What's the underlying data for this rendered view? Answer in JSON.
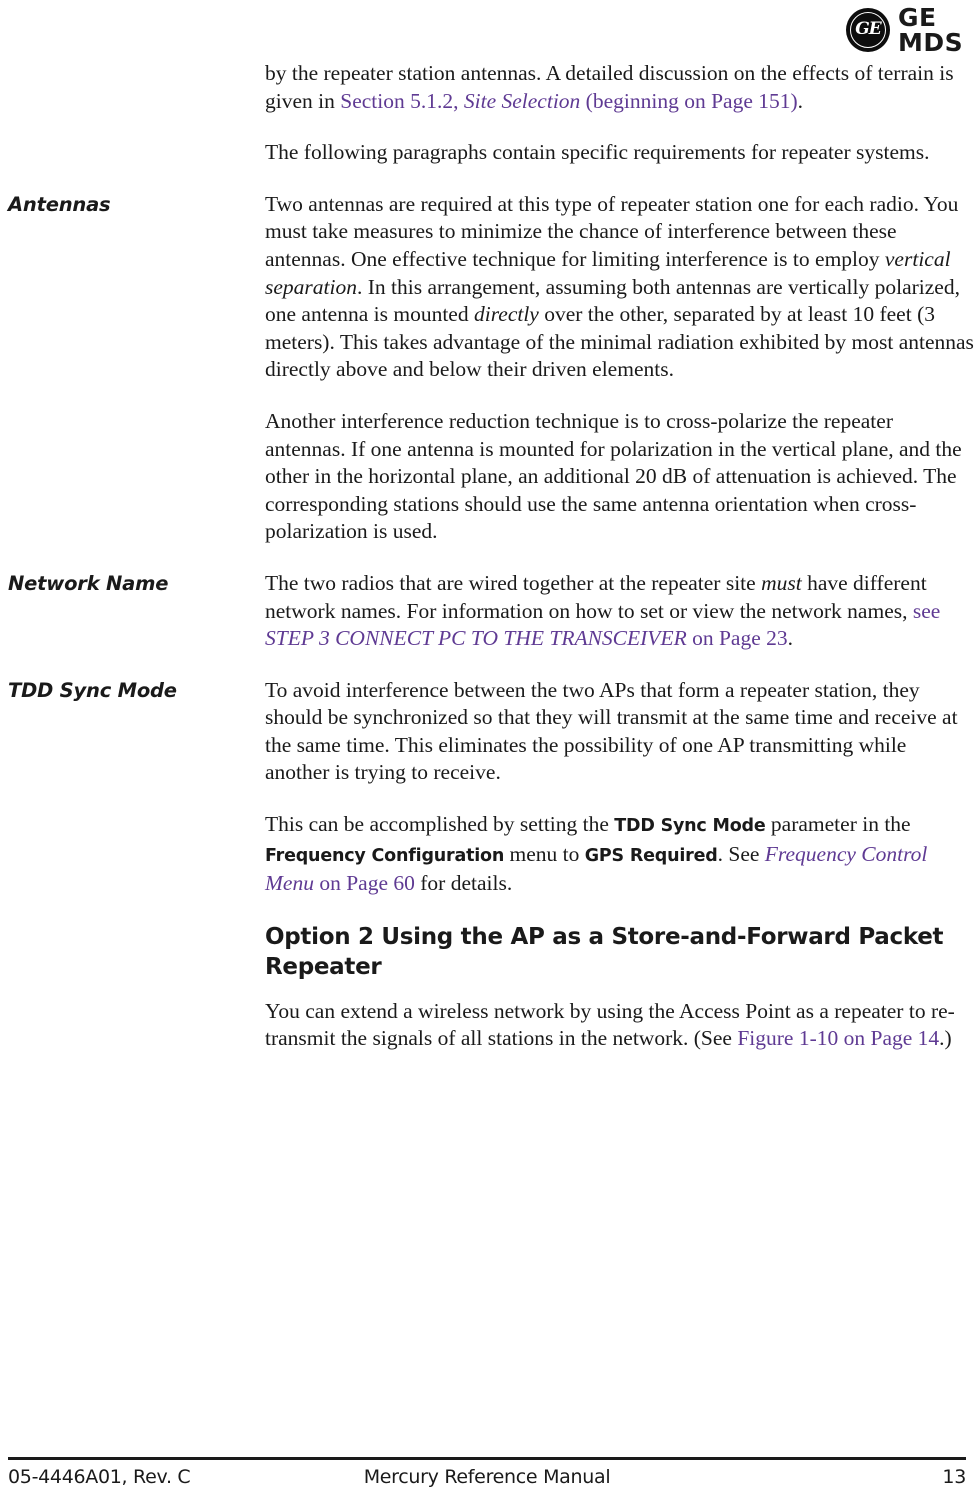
{
  "logo": {
    "monogram_text": "GE",
    "wordmark": "GE MDS"
  },
  "body": {
    "intro_paragraph_1_a": "by the repeater station antennas. A detailed discussion on the effects of terrain is given in ",
    "intro_paragraph_1_link_1": "Section 5.1.2, ",
    "intro_paragraph_1_link_1_italic": "Site Selection",
    "intro_paragraph_1_link_2": " (beginning on Page 151)",
    "intro_paragraph_1_end": ".",
    "intro_paragraph_2": "The following paragraphs contain specific requirements for repeater systems."
  },
  "antennas": {
    "heading": "Antennas",
    "para1_a": "Two antennas are required at this type of repeater station   one for each radio. You must take measures to minimize the chance of interference between these antennas. One effective technique for limiting interference is to employ ",
    "para1_italic1": "vertical separation",
    "para1_b": ". In this arrangement, assuming both antennas are vertically polarized, one antenna is mounted ",
    "para1_italic2": "directly",
    "para1_c": " over the other, separated by at least 10 feet (3 meters). This takes advantage of the minimal radiation exhibited by most antennas directly above and below their driven elements.",
    "para2": "Another interference reduction technique is to cross-polarize the repeater antennas. If one antenna is mounted for polarization in the vertical plane, and the other in the horizontal plane, an additional 20 dB of attenuation is achieved. The corresponding stations should use the same antenna orientation when cross-polarization is used."
  },
  "network_name": {
    "heading": "Network Name",
    "para_a": "The two radios that are wired together at the repeater site ",
    "para_italic": "must",
    "para_b": " have different network names. For information on how to set or view the network names, ",
    "link_see": "see  ",
    "link_title": "STEP 3   CONNECT PC TO THE TRANSCEIVER",
    "link_page": " on Page 23",
    "para_end": "."
  },
  "tdd_sync_mode": {
    "heading": "TDD Sync Mode",
    "para1": "To avoid interference between the two APs that form a repeater station, they should be synchronized so that they will transmit at the same time and receive at the same time. This eliminates the possibility of one AP transmitting while another is trying to receive.",
    "para2_a": "This can be accomplished by setting the ",
    "para2_param1": "TDD Sync Mode",
    "para2_b": " parameter in the ",
    "para2_param2": "Frequency Configuration",
    "para2_c": " menu to ",
    "para2_param3": "GPS Required",
    "para2_d": ". See ",
    "para2_link_italic": "Frequency Control Menu",
    "para2_link_page": " on Page 60",
    "para2_end": " for details."
  },
  "option2": {
    "heading": "Option 2   Using the AP as a Store-and-Forward Packet Repeater",
    "para_a": "You can extend a wireless network by using the Access Point as a repeater to re-transmit the signals of all stations in the network. (See ",
    "para_link": "Figure 1-10 on Page 14",
    "para_end": ".)"
  },
  "footer": {
    "document_number": "05-4446A01, Rev. C",
    "manual_title": "Mercury Reference Manual",
    "page_number": "13"
  },
  "colors": {
    "link": "#5f3a93",
    "text": "#1a1a1a",
    "background": "#ffffff"
  }
}
